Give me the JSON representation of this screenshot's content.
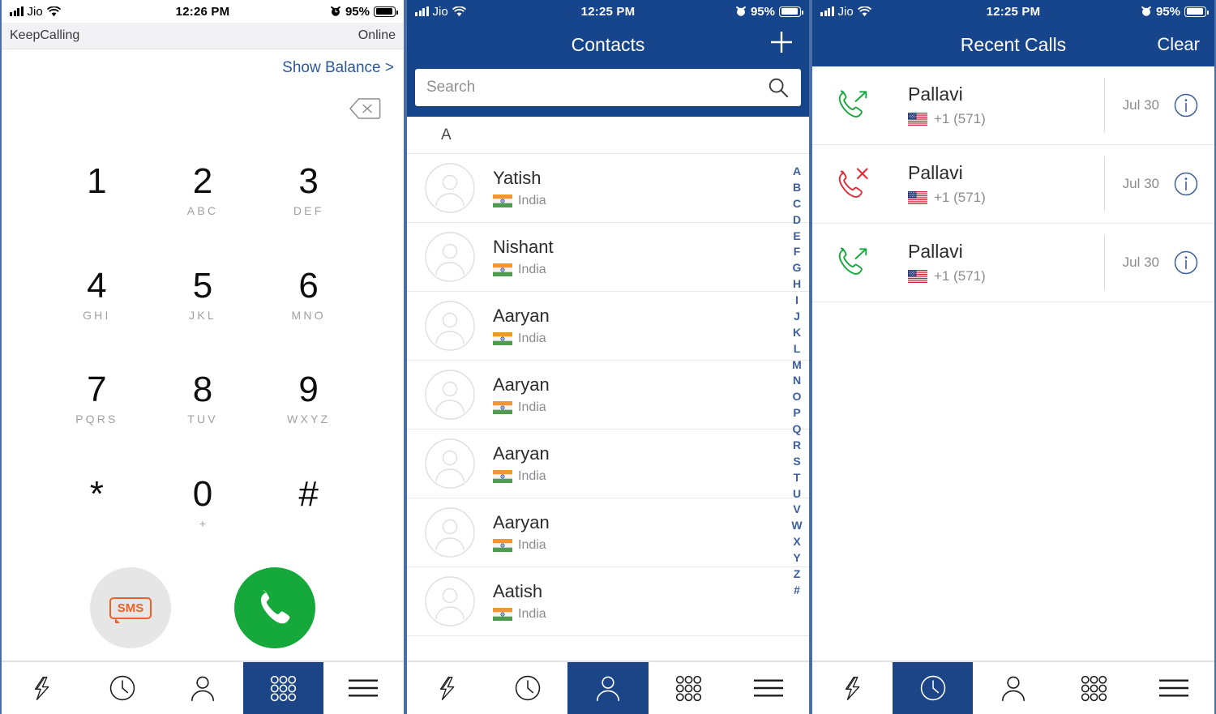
{
  "colors": {
    "navy": "#17458c",
    "tab_active": "#1c4587",
    "link_blue": "#2d5999",
    "call_green": "#14a93a",
    "missed_red": "#e02b36",
    "sms_orange": "#e8622a",
    "index_blue": "#3d5f9e"
  },
  "screen1": {
    "status": {
      "carrier": "Jio",
      "time": "12:26 PM",
      "battery": "95%",
      "wifi_icon": "wifi-icon",
      "signal_icon": "signal-bars-icon",
      "alarm_icon": "alarm-clock-icon",
      "battery_icon": "battery-icon"
    },
    "account": {
      "name": "KeepCalling",
      "status": "Online"
    },
    "balance_label": "Show Balance >",
    "backspace_icon": "backspace-icon",
    "keys": [
      {
        "digit": "1",
        "sub": ""
      },
      {
        "digit": "2",
        "sub": "ABC"
      },
      {
        "digit": "3",
        "sub": "DEF"
      },
      {
        "digit": "4",
        "sub": "GHI"
      },
      {
        "digit": "5",
        "sub": "JKL"
      },
      {
        "digit": "6",
        "sub": "MNO"
      },
      {
        "digit": "7",
        "sub": "PQRS"
      },
      {
        "digit": "8",
        "sub": "TUV"
      },
      {
        "digit": "9",
        "sub": "WXYZ"
      },
      {
        "digit": "*",
        "sub": ""
      },
      {
        "digit": "0",
        "sub": "+"
      },
      {
        "digit": "#",
        "sub": ""
      }
    ],
    "sms_label": "SMS",
    "call_icon": "phone-handset-icon",
    "tabs": [
      {
        "name": "tab-quick-dial",
        "icon": "lightning-bolt-icon",
        "active": false
      },
      {
        "name": "tab-recent-calls",
        "icon": "clock-icon",
        "active": false
      },
      {
        "name": "tab-contacts",
        "icon": "person-icon",
        "active": false
      },
      {
        "name": "tab-keypad",
        "icon": "dialpad-icon",
        "active": true
      },
      {
        "name": "tab-menu",
        "icon": "hamburger-menu-icon",
        "active": false
      }
    ]
  },
  "screen2": {
    "status": {
      "carrier": "Jio",
      "time": "12:25 PM",
      "battery": "95%"
    },
    "nav": {
      "title": "Contacts",
      "add_icon": "plus-icon"
    },
    "search": {
      "placeholder": "Search",
      "value": "",
      "icon": "search-icon"
    },
    "section_header": "A",
    "contacts": [
      {
        "name": "Yatish",
        "country": "India",
        "flag": "india-flag-icon"
      },
      {
        "name": "Nishant",
        "country": "India",
        "flag": "india-flag-icon"
      },
      {
        "name": "Aaryan",
        "country": "India",
        "flag": "india-flag-icon"
      },
      {
        "name": "Aaryan",
        "country": "India",
        "flag": "india-flag-icon"
      },
      {
        "name": "Aaryan",
        "country": "India",
        "flag": "india-flag-icon"
      },
      {
        "name": "Aaryan",
        "country": "India",
        "flag": "india-flag-icon"
      },
      {
        "name": "Aatish",
        "country": "India",
        "flag": "india-flag-icon"
      }
    ],
    "index_letters": [
      "A",
      "B",
      "C",
      "D",
      "E",
      "F",
      "G",
      "H",
      "I",
      "J",
      "K",
      "L",
      "M",
      "N",
      "O",
      "P",
      "Q",
      "R",
      "S",
      "T",
      "U",
      "V",
      "W",
      "X",
      "Y",
      "Z",
      "#"
    ],
    "tabs": [
      {
        "name": "tab-quick-dial",
        "icon": "lightning-bolt-icon",
        "active": false
      },
      {
        "name": "tab-recent-calls",
        "icon": "clock-icon",
        "active": false
      },
      {
        "name": "tab-contacts",
        "icon": "person-icon",
        "active": true
      },
      {
        "name": "tab-keypad",
        "icon": "dialpad-icon",
        "active": false
      },
      {
        "name": "tab-menu",
        "icon": "hamburger-menu-icon",
        "active": false
      }
    ]
  },
  "screen3": {
    "status": {
      "carrier": "Jio",
      "time": "12:25 PM",
      "battery": "95%"
    },
    "nav": {
      "title": "Recent Calls",
      "action": "Clear"
    },
    "calls": [
      {
        "name": "Pallavi",
        "number": "+1 (571)",
        "date": "Jul 30",
        "type": "outgoing",
        "icon": "outgoing-call-icon",
        "flag": "us-flag-icon",
        "info_icon": "info-icon"
      },
      {
        "name": "Pallavi",
        "number": "+1 (571)",
        "date": "Jul 30",
        "type": "missed",
        "icon": "missed-call-icon",
        "flag": "us-flag-icon",
        "info_icon": "info-icon"
      },
      {
        "name": "Pallavi",
        "number": "+1 (571)",
        "date": "Jul 30",
        "type": "outgoing",
        "icon": "outgoing-call-icon",
        "flag": "us-flag-icon",
        "info_icon": "info-icon"
      }
    ],
    "tabs": [
      {
        "name": "tab-quick-dial",
        "icon": "lightning-bolt-icon",
        "active": false
      },
      {
        "name": "tab-recent-calls",
        "icon": "clock-icon",
        "active": true
      },
      {
        "name": "tab-contacts",
        "icon": "person-icon",
        "active": false
      },
      {
        "name": "tab-keypad",
        "icon": "dialpad-icon",
        "active": false
      },
      {
        "name": "tab-menu",
        "icon": "hamburger-menu-icon",
        "active": false
      }
    ]
  }
}
